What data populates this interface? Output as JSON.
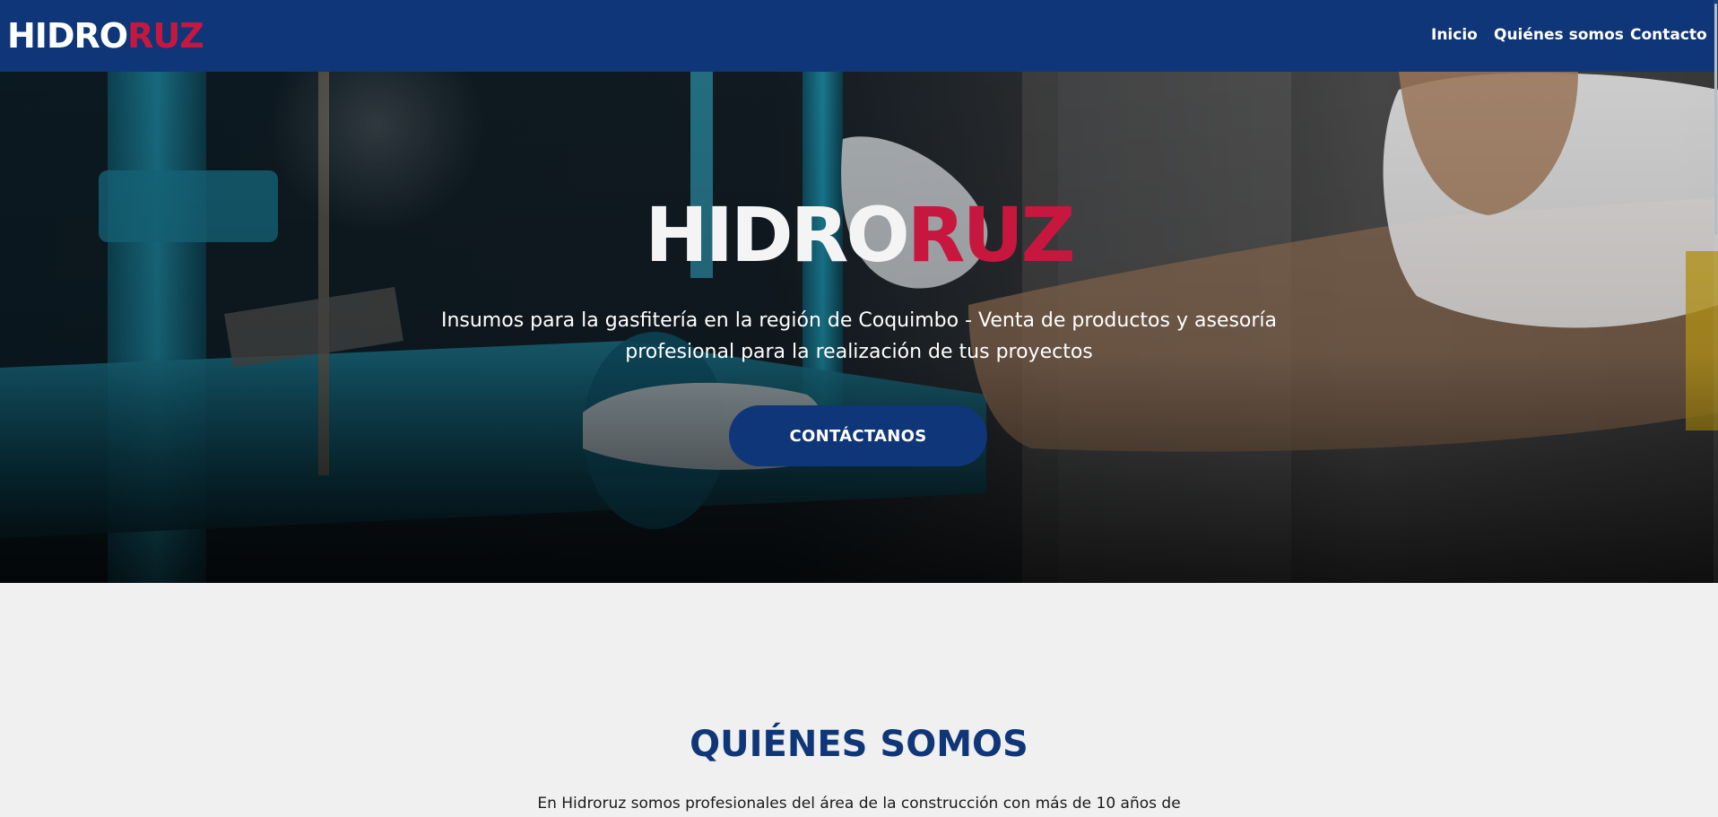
{
  "navbar": {
    "brand": {
      "part1": "HIDRO",
      "part2": "RUZ"
    },
    "links": [
      {
        "label": "Inicio"
      },
      {
        "label": "Quiénes somos"
      },
      {
        "label": "Contacto"
      }
    ]
  },
  "hero": {
    "title": {
      "part1": "HIDRO",
      "part2": "RUZ"
    },
    "subtitle": "Insumos para la gasfitería en la región de Coquimbo - Venta de productos y asesoría profesional para la realización de tus proyectos",
    "cta_label": "CONTÁCTANOS"
  },
  "about": {
    "title": "QUIÉNES SOMOS",
    "text": "En Hidroruz somos profesionales del área de la construcción con más de 10 años de"
  },
  "colors": {
    "brand_blue": "#0f3678",
    "brand_red": "#c8173f",
    "background": "#f0f0f0"
  }
}
